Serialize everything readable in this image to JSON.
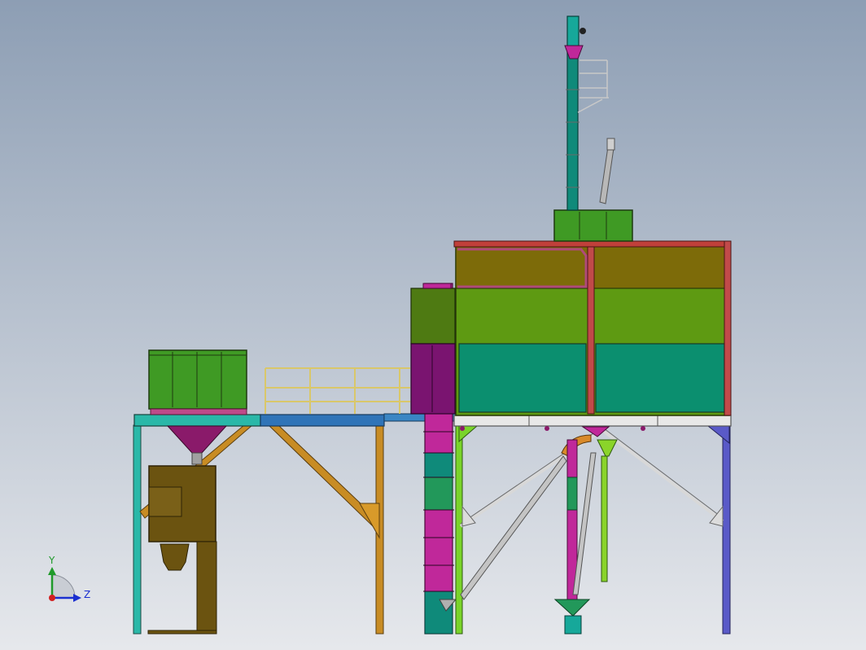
{
  "viewport": {
    "background_top": "#8d9eb4",
    "background_bottom": "#e6e8ec"
  },
  "triad": {
    "y_label": "Y",
    "z_label": "Z",
    "y_color": "#1f9a2a",
    "z_color": "#1a2fd0",
    "origin_color": "#d22020"
  },
  "colors": {
    "bin_olive": "#7d6b09",
    "bin_green": "#5e9a12",
    "bin_teal": "#0b8f6f",
    "bin_frame": "#c14a4a",
    "roof_red": "#c0403a",
    "elevator_magenta": "#9b1c7e",
    "elevator_teal": "#0f8a7a",
    "elevator_green": "#22985a",
    "dark_green": "#4e7a12",
    "purple": "#7a1470",
    "cyan_beam": "#2ab8a8",
    "blue_beam": "#2f74b8",
    "brown_feeder": "#6b5310",
    "orange_brace": "#c88c24",
    "lime_leg": "#7ad42a",
    "gray_pipe": "#b8b8b8",
    "violet_leg": "#5a5ac8",
    "railing": "#d9c76a"
  }
}
